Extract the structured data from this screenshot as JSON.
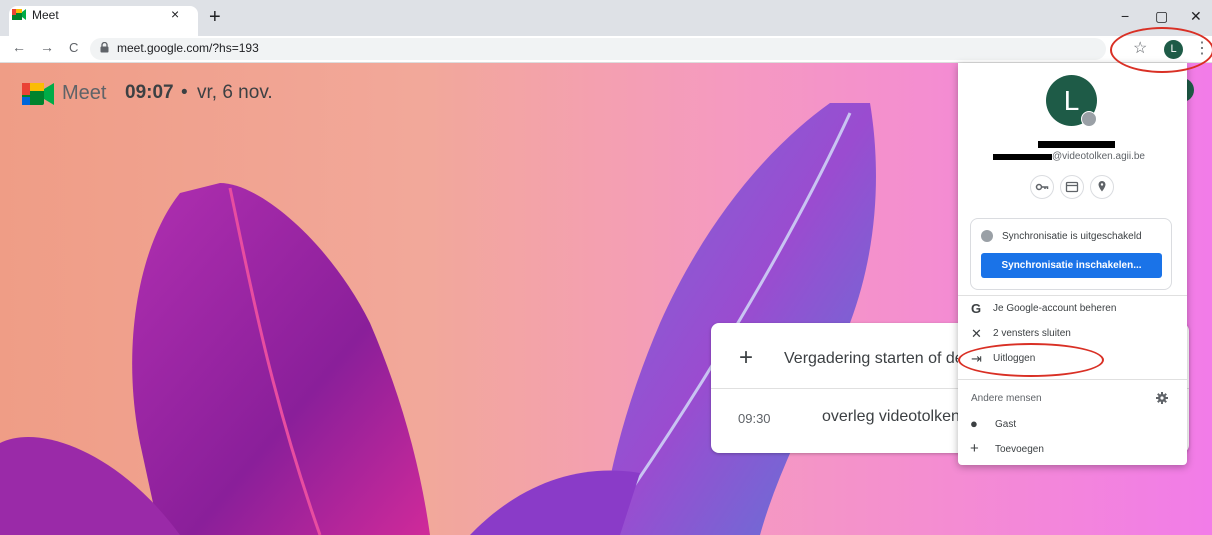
{
  "browser": {
    "tab_title": "Meet",
    "tab_close": "×",
    "new_tab": "+",
    "minimize": "−",
    "maximize": "▢",
    "close": "✕",
    "back": "←",
    "forward": "→",
    "reload": "C",
    "url": "meet.google.com/?hs=193",
    "star": "☆",
    "avatar_letter": "L",
    "menu": "⋮"
  },
  "meet": {
    "app_name": "Meet",
    "time": "09:07",
    "separator": "•",
    "date": "vr, 6 nov.",
    "start_icon": "+",
    "start_label": "Vergadering starten of deelnemen",
    "meeting_time": "09:30",
    "meeting_title": "overleg videotolken"
  },
  "profile_menu": {
    "avatar_letter": "L",
    "email_suffix": "@videotolken.agii.be",
    "sync_status": "Synchronisatie is uitgeschakeld",
    "sync_button": "Synchronisatie inschakelen...",
    "items": [
      {
        "icon": "G",
        "label": "Je Google-account beheren"
      },
      {
        "icon": "✕",
        "label": "2 vensters sluiten"
      },
      {
        "icon": "⇥",
        "label": "Uitloggen"
      }
    ],
    "others_label": "Andere mensen",
    "people": [
      {
        "icon": "●",
        "label": "Gast"
      },
      {
        "icon": "+",
        "label": "Toevoegen"
      }
    ]
  },
  "colors": {
    "avatar_green": "#1e5b47",
    "sync_blue": "#1a73e8",
    "annotation_red": "#d93025"
  }
}
